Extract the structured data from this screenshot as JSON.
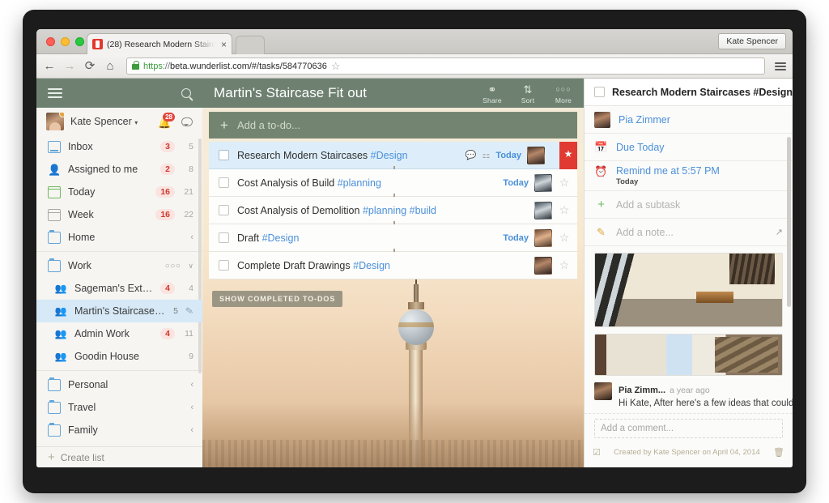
{
  "browser": {
    "tab_title": "(28) Research Modern Stairc",
    "tab_close": "×",
    "url_scheme": "https",
    "url_sep": "://",
    "url_host": "beta.wunderlist.com",
    "url_path": "/#/tasks/584770636",
    "profile_label": "Kate Spencer",
    "back": "←",
    "forward": "→",
    "reload": "⟳",
    "home": "⌂",
    "bookmark_star": "☆"
  },
  "sidebar": {
    "search_icon": "search-icon",
    "menu_icon": "hamburger-icon",
    "user": {
      "name": "Kate Spencer",
      "caret": "▾",
      "notification_count": "28",
      "bell_icon": "bell-icon",
      "chat_icon": "chat-bubble-icon"
    },
    "smart_lists": [
      {
        "label": "Inbox",
        "icon": "inbox-icon",
        "badge": "3",
        "count": "5"
      },
      {
        "label": "Assigned to me",
        "icon": "assigned-icon",
        "badge": "2",
        "count": "8"
      },
      {
        "label": "Today",
        "icon": "calendar-icon",
        "badge": "16",
        "count": "21"
      },
      {
        "label": "Week",
        "icon": "week-icon",
        "badge": "16",
        "count": "22"
      }
    ],
    "groups": [
      {
        "label": "Home",
        "icon": "folder-icon",
        "chevron": "‹",
        "expanded": false
      },
      {
        "label": "Work",
        "icon": "folder-icon",
        "chevron": "∨",
        "dots": "○○○",
        "expanded": true
      }
    ],
    "work_lists": [
      {
        "label": "Sageman's Extension",
        "badge": "4",
        "count": "4",
        "active": false
      },
      {
        "label": "Martin's Staircase Fit o..",
        "count": "5",
        "active": true,
        "edit_icon": "pencil-icon"
      },
      {
        "label": "Admin Work",
        "badge": "4",
        "count": "11",
        "active": false
      },
      {
        "label": "Goodin House",
        "count": "9",
        "active": false
      }
    ],
    "other_groups": [
      {
        "label": "Personal",
        "icon": "folder-icon",
        "chevron": "‹"
      },
      {
        "label": "Travel",
        "icon": "folder-icon",
        "chevron": "‹"
      },
      {
        "label": "Family",
        "icon": "folder-icon",
        "chevron": "‹"
      }
    ],
    "create_list": "Create list",
    "create_plus": "+"
  },
  "main": {
    "title": "Martin's Staircase Fit out",
    "actions": [
      {
        "label": "Share",
        "icon": "share-person-icon",
        "glyph": "⚇"
      },
      {
        "label": "Sort",
        "icon": "sort-az-icon",
        "glyph": "⇅"
      },
      {
        "label": "More",
        "icon": "more-dots-icon",
        "glyph": "○○○"
      }
    ],
    "add_todo_placeholder": "Add a to-do...",
    "add_todo_plus": "+",
    "todos": [
      {
        "title": "Research Modern Staircases",
        "tags": [
          "#Design"
        ],
        "due": "Today",
        "selected": true,
        "starred": true,
        "has_comment": true,
        "has_note": true,
        "comment_icon": "comment-icon",
        "note_icon": "note-icon",
        "avatar": "pia"
      },
      {
        "title": "Cost Analysis of Build",
        "tags": [
          "#planning"
        ],
        "due": "Today",
        "selected": false,
        "starred": false,
        "avatar": "cap"
      },
      {
        "title": "Cost Analysis of Demolition",
        "tags": [
          "#planning",
          "#build"
        ],
        "due": "",
        "selected": false,
        "starred": false,
        "avatar": "cap"
      },
      {
        "title": "Draft",
        "tags": [
          "#Design"
        ],
        "due": "Today",
        "selected": false,
        "starred": false,
        "avatar": "guy"
      },
      {
        "title": "Complete Draft Drawings",
        "tags": [
          "#Design"
        ],
        "due": "",
        "selected": false,
        "starred": false,
        "avatar": "pia"
      }
    ],
    "show_completed": "SHOW COMPLETED TO-DOS"
  },
  "detail": {
    "title": "Research Modern Staircases #Design",
    "star_glyph": "★",
    "assignee": "Pia Zimmer",
    "due": "Due Today",
    "due_icon": "calendar-icon",
    "reminder": "Remind me at 5:57 PM",
    "reminder_sub": "Today",
    "reminder_icon": "alarm-clock-icon",
    "add_subtask": "Add a subtask",
    "subtask_plus": "+",
    "add_note": "Add a note...",
    "note_icon": "pencil-icon",
    "note_expand_icon": "external-link-icon",
    "attachments": [
      {
        "name": "modern-room-fireplace",
        "alt": "minimal room with fireplace"
      },
      {
        "name": "staircase-interior",
        "alt": "interior staircase"
      }
    ],
    "comment": {
      "author": "Pia Zimm...",
      "time": "a year ago",
      "text": "Hi Kate, After here's a few ideas that could wor..."
    },
    "add_comment_placeholder": "Add a comment...",
    "footer_text": "Created by Kate Spencer on April 04, 2014",
    "footer_left_icon": "chat-activity-icon",
    "footer_right_icon": "trash-icon"
  },
  "colors": {
    "green_header": "#6e8171",
    "accent_blue": "#4a90d9",
    "badge_red": "#cf3b2c",
    "star_red": "#e03a32",
    "selected_row": "#ddeefa"
  }
}
